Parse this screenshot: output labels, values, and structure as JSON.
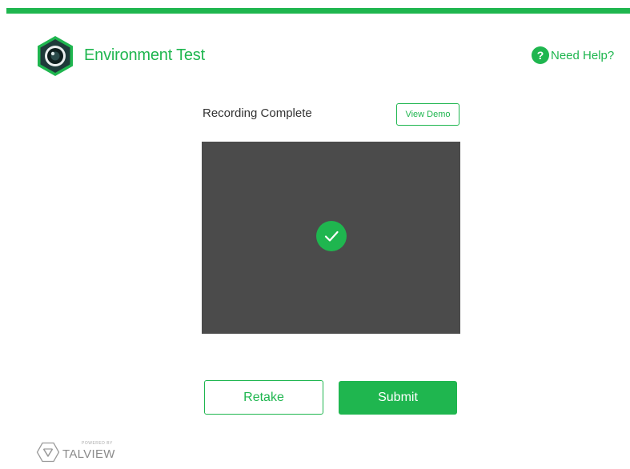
{
  "header": {
    "title": "Environment Test",
    "logo_icon": "webcam-hexagon-icon",
    "help": {
      "label": "Need Help?",
      "icon": "question-circle-icon"
    }
  },
  "recording": {
    "status": "Recording Complete",
    "view_demo_label": "View Demo",
    "status_icon": "check-circle-icon"
  },
  "actions": {
    "retake_label": "Retake",
    "submit_label": "Submit"
  },
  "footer": {
    "powered_by_label": "POWERED BY",
    "brand_name": "TALVIEW",
    "brand_icon": "talview-logo-icon"
  },
  "colors": {
    "accent": "#1fb64f",
    "preview_background": "#4b4b4b",
    "logo_dark": "#1e3a3a"
  }
}
